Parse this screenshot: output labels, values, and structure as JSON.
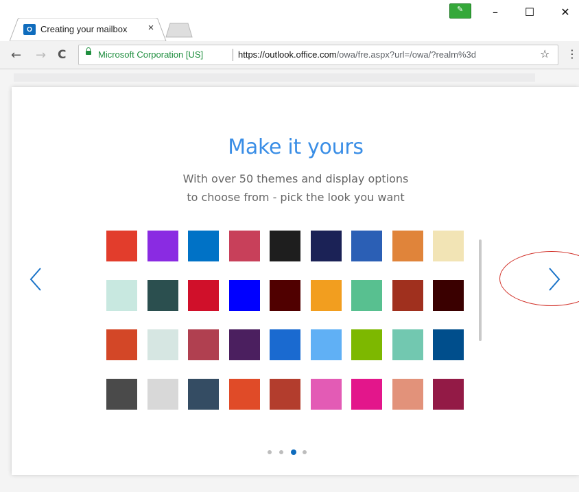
{
  "tab": {
    "title": "Creating your mailbox",
    "favicon": "outlook-icon",
    "close": "×"
  },
  "window": {
    "minimize": "–",
    "maximize": "☐",
    "close": "✕"
  },
  "toolbar": {
    "secure_label": "Microsoft Corporation [US]",
    "url_host": "https://outlook.office.com",
    "url_path": "/owa/fre.aspx?url=/owa/?realm%3d",
    "back": "←",
    "forward": "→",
    "reload": "C",
    "star": "☆",
    "menu": "⋮"
  },
  "card": {
    "title": "Make it yours",
    "subtitle_line1": "With over 50 themes and display options",
    "subtitle_line2": "to choose from - pick the look you want"
  },
  "colors": {
    "accent": "#0f6cbd",
    "title": "#3a8ee6",
    "annotation": "#d2332b"
  },
  "themes": [
    [
      "#e23d2c",
      "#8a2be2",
      "#0072c6",
      "#c8405a",
      "#1e1e1e",
      "#1b2256",
      "#2b5fb5",
      "#e0843a",
      "#f2e4b5"
    ],
    [
      "#c8e8e0",
      "#2b4f4f",
      "#d0102a",
      "#0000ff",
      "#500000",
      "#f29e1f",
      "#58c090",
      "#a0301e",
      "#3a0000"
    ],
    [
      "#d34727",
      "#d6e6e2",
      "#b04050",
      "#4b1f5f",
      "#1a6ad0",
      "#60b0f5",
      "#7db800",
      "#72c8b0",
      "#004e8c"
    ],
    [
      "#4a4a4a",
      "#d8d8d8",
      "#344c63",
      "#e04b28",
      "#b33d2d",
      "#e35bb5",
      "#e3168b",
      "#e2927a",
      "#931a46"
    ]
  ],
  "pagination": {
    "total": 4,
    "active_index": 2
  }
}
